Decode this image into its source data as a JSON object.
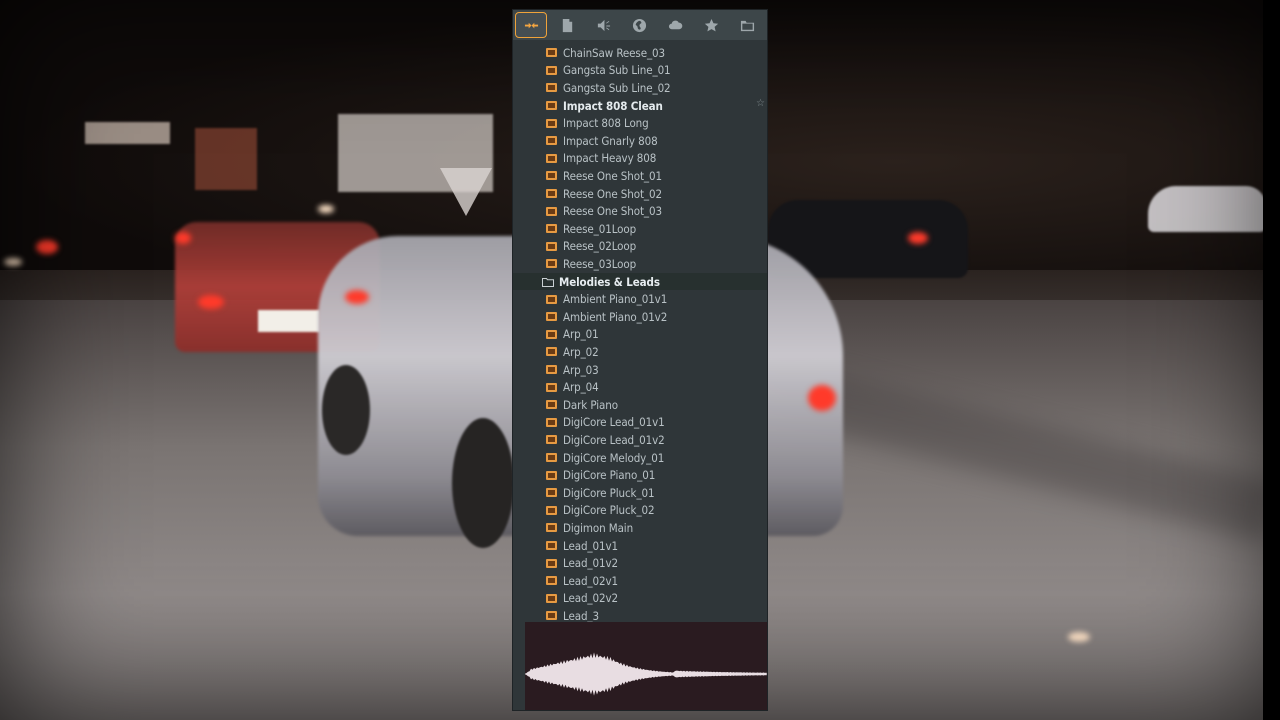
{
  "toolbar": {
    "buttons": [
      {
        "name": "all-tab",
        "icon": "plugin-arrows-icon",
        "active": true
      },
      {
        "name": "files-tab",
        "icon": "document-icon",
        "active": false
      },
      {
        "name": "sounds-tab",
        "icon": "speaker-icon",
        "active": false
      },
      {
        "name": "plugin-db-tab",
        "icon": "globe-icon",
        "active": false
      },
      {
        "name": "cloud-tab",
        "icon": "cloud-icon",
        "active": false
      },
      {
        "name": "favorites-tab",
        "icon": "star-icon",
        "active": false
      },
      {
        "name": "folder-tab",
        "icon": "folder-icon",
        "active": false
      }
    ]
  },
  "browser": {
    "items": [
      {
        "label": "ChainSaw Reese_03",
        "type": "file"
      },
      {
        "label": "Gangsta Sub Line_01",
        "type": "file"
      },
      {
        "label": "Gangsta Sub Line_02",
        "type": "file"
      },
      {
        "label": "Impact 808 Clean",
        "type": "file",
        "highlight": true
      },
      {
        "label": "Impact 808 Long",
        "type": "file"
      },
      {
        "label": "Impact Gnarly 808",
        "type": "file"
      },
      {
        "label": "Impact Heavy 808",
        "type": "file"
      },
      {
        "label": "Reese One Shot_01",
        "type": "file"
      },
      {
        "label": "Reese One Shot_02",
        "type": "file"
      },
      {
        "label": "Reese One Shot_03",
        "type": "file"
      },
      {
        "label": "Reese_01Loop",
        "type": "file"
      },
      {
        "label": "Reese_02Loop",
        "type": "file"
      },
      {
        "label": "Reese_03Loop",
        "type": "file"
      },
      {
        "label": "Melodies & Leads",
        "type": "folder"
      },
      {
        "label": "Ambient Piano_01v1",
        "type": "file"
      },
      {
        "label": "Ambient Piano_01v2",
        "type": "file"
      },
      {
        "label": "Arp_01",
        "type": "file"
      },
      {
        "label": "Arp_02",
        "type": "file"
      },
      {
        "label": "Arp_03",
        "type": "file"
      },
      {
        "label": "Arp_04",
        "type": "file"
      },
      {
        "label": "Dark Piano",
        "type": "file"
      },
      {
        "label": "DigiCore Lead_01v1",
        "type": "file"
      },
      {
        "label": "DigiCore Lead_01v2",
        "type": "file"
      },
      {
        "label": "DigiCore Melody_01",
        "type": "file"
      },
      {
        "label": "DigiCore Piano_01",
        "type": "file"
      },
      {
        "label": "DigiCore Pluck_01",
        "type": "file"
      },
      {
        "label": "DigiCore Pluck_02",
        "type": "file"
      },
      {
        "label": "Digimon Main",
        "type": "file"
      },
      {
        "label": "Lead_01v1",
        "type": "file"
      },
      {
        "label": "Lead_01v2",
        "type": "file"
      },
      {
        "label": "Lead_02v1",
        "type": "file"
      },
      {
        "label": "Lead_02v2",
        "type": "file"
      },
      {
        "label": "Lead_3",
        "type": "file"
      }
    ],
    "favorite_marker": "☆"
  },
  "colors": {
    "accent": "#f0a33a",
    "panel_bg": "#2f3639",
    "waveform": "#e8dde2"
  }
}
